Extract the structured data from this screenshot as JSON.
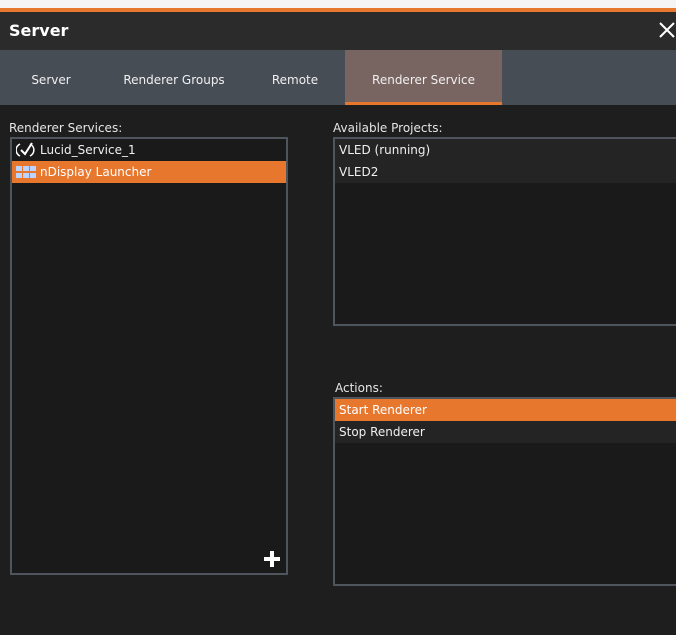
{
  "window": {
    "title": "Server"
  },
  "tabs": [
    {
      "label": "Server"
    },
    {
      "label": "Renderer Groups"
    },
    {
      "label": "Remote"
    },
    {
      "label": "Renderer Service",
      "active": true
    }
  ],
  "renderer_services": {
    "label": "Renderer Services:",
    "items": [
      {
        "label": "Lucid_Service_1",
        "icon": "checkmark-circle-icon"
      },
      {
        "label": "nDisplay Launcher",
        "icon": "grid-icon",
        "selected": true
      }
    ]
  },
  "available_projects": {
    "label": "Available Projects:",
    "items": [
      {
        "label": "VLED (running)"
      },
      {
        "label": "VLED2"
      }
    ]
  },
  "actions": {
    "label": "Actions:",
    "items": [
      {
        "label": "Start Renderer",
        "selected": true
      },
      {
        "label": "Stop Renderer"
      }
    ]
  },
  "colors": {
    "accent": "#e8772e",
    "tabbar": "#474d55",
    "active_tab": "#786460",
    "background": "#1e1e1e"
  }
}
